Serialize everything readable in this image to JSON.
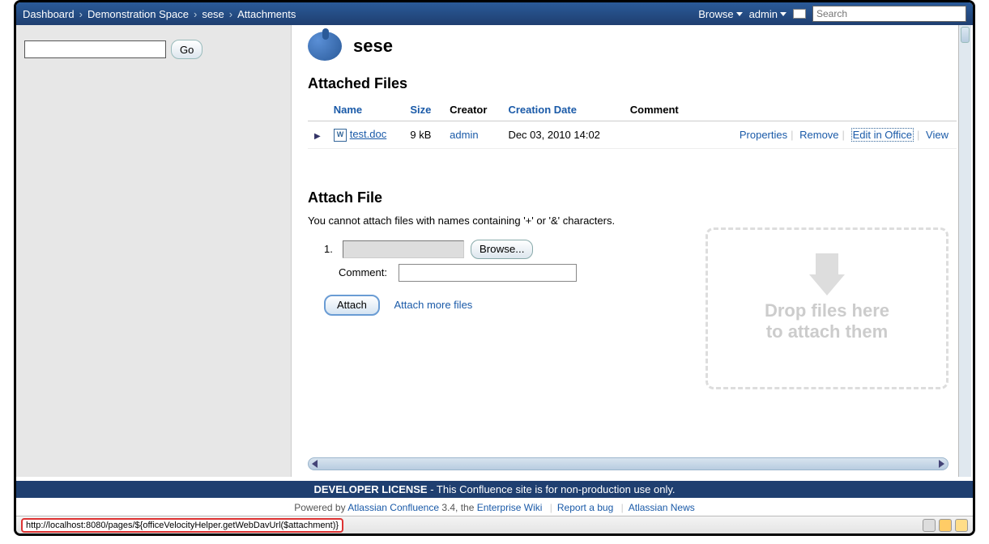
{
  "breadcrumbs": [
    "Dashboard",
    "Demonstration Space",
    "sese",
    "Attachments"
  ],
  "nav": {
    "browse": "Browse",
    "user": "admin",
    "search_placeholder": "Search"
  },
  "sidebar": {
    "go": "Go"
  },
  "page": {
    "title": "sese"
  },
  "attached": {
    "heading": "Attached Files",
    "columns": {
      "name": "Name",
      "size": "Size",
      "creator": "Creator",
      "date": "Creation Date",
      "comment": "Comment"
    },
    "rows": [
      {
        "file": "test.doc",
        "size": "9 kB",
        "creator": "admin",
        "date": "Dec 03, 2010 14:02",
        "comment": ""
      }
    ],
    "actions": {
      "properties": "Properties",
      "remove": "Remove",
      "edit": "Edit in Office",
      "view": "View"
    }
  },
  "attach": {
    "heading": "Attach File",
    "warning": "You cannot attach files with names containing '+' or '&' characters.",
    "num": "1.",
    "browse": "Browse...",
    "comment_label": "Comment:",
    "button": "Attach",
    "more": "Attach more files",
    "drop1": "Drop files here",
    "drop2": "to attach them"
  },
  "footer": {
    "license_bold": "DEVELOPER LICENSE",
    "license_rest": " - This Confluence site is for non-production use only.",
    "powered_pre": "Powered by ",
    "powered_link": "Atlassian Confluence",
    "powered_ver": " 3.4, the ",
    "powered_wiki": "Enterprise Wiki",
    "bug": "Report a bug",
    "news": "Atlassian News"
  },
  "status_url": "http://localhost:8080/pages/${officeVelocityHelper.getWebDavUrl($attachment)}"
}
